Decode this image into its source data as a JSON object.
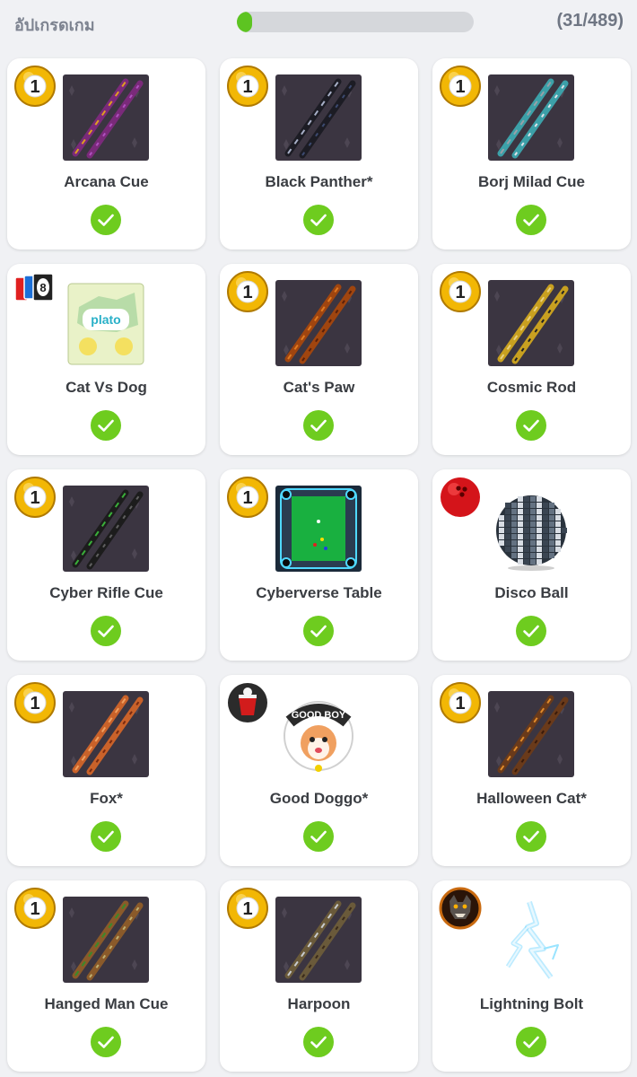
{
  "header": {
    "title": "อัปเกรดเกม",
    "progress_count": "(31/489)",
    "progress_fraction": 0.063
  },
  "colors": {
    "progress_fill": "#5dc421",
    "check_green": "#6ecc1f",
    "pool_ball_yellow": "#f2b705",
    "card_background": "#ffffff",
    "page_background": "#f0f1f4"
  },
  "items": [
    {
      "name": "Arcana Cue",
      "badge_icon": "pool-ball-1-icon",
      "image": "cue-image",
      "owned": true
    },
    {
      "name": "Black Panther*",
      "badge_icon": "pool-ball-1-icon",
      "image": "cue-image",
      "owned": true
    },
    {
      "name": "Borj Milad Cue",
      "badge_icon": "pool-ball-1-icon",
      "image": "cue-image",
      "owned": true
    },
    {
      "name": "Cat Vs Dog",
      "badge_icon": "uno-cards-icon",
      "image": "plato-sticker-image",
      "owned": true
    },
    {
      "name": "Cat's Paw",
      "badge_icon": "pool-ball-1-icon",
      "image": "cue-image",
      "owned": true
    },
    {
      "name": "Cosmic Rod",
      "badge_icon": "pool-ball-1-icon",
      "image": "cue-image",
      "owned": true
    },
    {
      "name": "Cyber Rifle Cue",
      "badge_icon": "pool-ball-1-icon",
      "image": "cue-image",
      "owned": true
    },
    {
      "name": "Cyberverse Table",
      "badge_icon": "pool-ball-1-icon",
      "image": "pool-table-image",
      "owned": true
    },
    {
      "name": "Disco Ball",
      "badge_icon": "bowling-ball-icon",
      "image": "disco-ball-image",
      "owned": true
    },
    {
      "name": "Fox*",
      "badge_icon": "pool-ball-1-icon",
      "image": "cue-image",
      "owned": true
    },
    {
      "name": "Good Doggo*",
      "badge_icon": "beer-pong-cup-icon",
      "image": "good-boy-sticker-image",
      "sticker_text": "GOOD BOY",
      "owned": true
    },
    {
      "name": "Halloween Cat*",
      "badge_icon": "pool-ball-1-icon",
      "image": "cue-image",
      "owned": true
    },
    {
      "name": "Hanged Man Cue",
      "badge_icon": "pool-ball-1-icon",
      "image": "cue-image",
      "owned": true
    },
    {
      "name": "Harpoon",
      "badge_icon": "pool-ball-1-icon",
      "image": "cue-image",
      "owned": true
    },
    {
      "name": "Lightning Bolt",
      "badge_icon": "werewolf-icon",
      "image": "lightning-bolt-image",
      "owned": true
    }
  ]
}
